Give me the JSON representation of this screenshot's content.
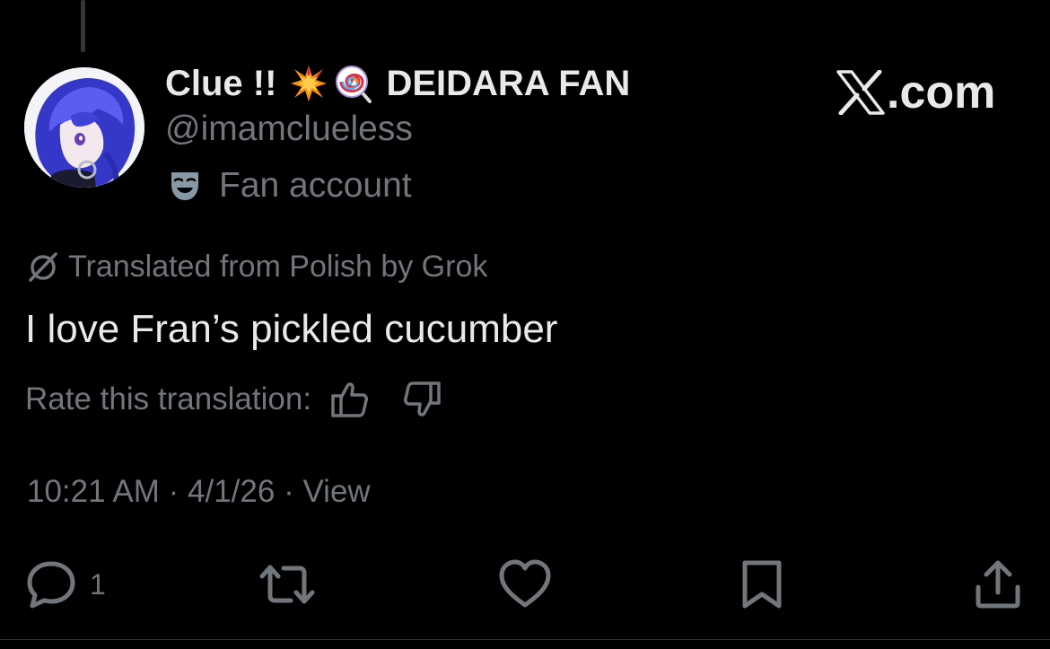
{
  "author": {
    "display_name": "Clue !!",
    "name_suffix": "DEIDARA FAN",
    "name_emojis": [
      "collision-icon",
      "lollipop-icon"
    ],
    "handle": "@imamclueless",
    "account_label": "Fan account",
    "account_label_icon": "performing-arts-mask-icon"
  },
  "watermark": {
    "suffix": ".com",
    "icon": "x-logo-icon"
  },
  "translation": {
    "notice": "Translated from Polish by Grok",
    "icon": "grok-icon",
    "rate_label": "Rate this translation:"
  },
  "post": {
    "text": "I love Fran’s pickled cucumber",
    "time": "10:21 AM",
    "date": "4/1/26",
    "separator": "·",
    "view_label": "View"
  },
  "actions": {
    "reply_count": "1"
  },
  "colors": {
    "background": "#000000",
    "primary_text": "#e7e9ea",
    "secondary_text": "#71767b",
    "avatar_hair": "#3d3fd8"
  }
}
